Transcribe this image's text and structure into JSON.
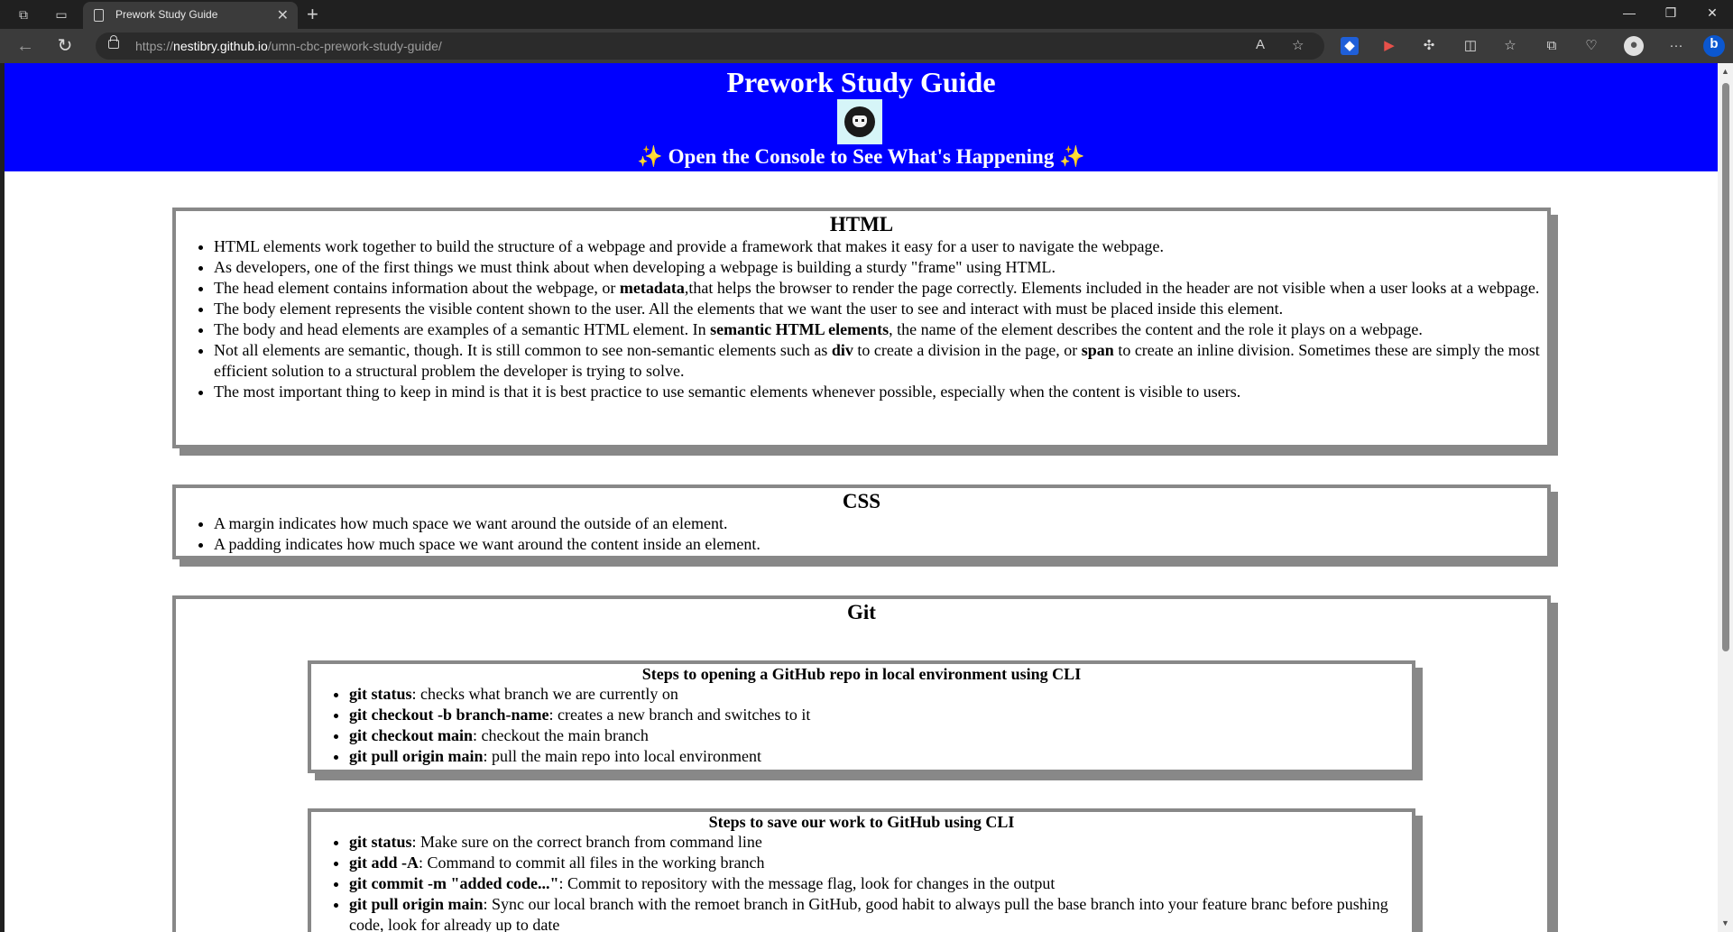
{
  "browser": {
    "tab_title": "Prework Study Guide",
    "url_prefix": "https://",
    "url_host": "nestibry.github.io",
    "url_path": "/umn-cbc-prework-study-guide/"
  },
  "header": {
    "title": "Prework Study Guide",
    "subtitle": "✨ Open the Console to See What's Happening ✨",
    "colors": {
      "background": "#0000ff",
      "text": "#ffffff"
    }
  },
  "sections": {
    "html": {
      "title": "HTML",
      "items": [
        [
          "HTML elements work together to build the structure of a webpage and provide a framework that makes it easy for a user to navigate the webpage."
        ],
        [
          "As developers, one of the first things we must think about when developing a webpage is building a sturdy \"frame\" using HTML."
        ],
        [
          "The head element contains information about the webpage, or ",
          "metadata",
          ",that helps the browser to render the page correctly. Elements included in the header are not visible when a user looks at a webpage."
        ],
        [
          "The body element represents the visible content shown to the user. All the elements that we want the user to see and interact with must be placed inside this element."
        ],
        [
          "The body and head elements are examples of a semantic HTML element. In ",
          "semantic HTML elements",
          ", the name of the element describes the content and the role it plays on a webpage."
        ],
        [
          "Not all elements are semantic, though. It is still common to see non-semantic elements such as ",
          "div",
          " to create a division in the page, or ",
          "span",
          " to create an inline division. Sometimes these are simply the most efficient solution to a structural problem the developer is trying to solve."
        ],
        [
          "The most important thing to keep in mind is that it is best practice to use semantic elements whenever possible, especially when the content is visible to users."
        ]
      ]
    },
    "css": {
      "title": "CSS",
      "items": [
        [
          "A margin indicates how much space we want around the outside of an element."
        ],
        [
          "A padding indicates how much space we want around the content inside an element."
        ]
      ]
    },
    "git": {
      "title": "Git",
      "groups": [
        {
          "title": "Steps to opening a GitHub repo in local environment using CLI",
          "items": [
            [
              "",
              "git status",
              ": checks what branch we are currently on"
            ],
            [
              "",
              "git checkout -b branch-name",
              ": creates a new branch and switches to it"
            ],
            [
              "",
              "git checkout main",
              ": checkout the main branch"
            ],
            [
              "",
              "git pull origin main",
              ": pull the main repo into local environment"
            ]
          ]
        },
        {
          "title": "Steps to save our work to GitHub using CLI",
          "items": [
            [
              "",
              "git status",
              ": Make sure on the correct branch from command line"
            ],
            [
              "",
              "git add -A",
              ": Command to commit all files in the working branch"
            ],
            [
              "",
              "git commit -m \"added code...\"",
              ": Commit to repository with the message flag, look for changes in the output"
            ],
            [
              "",
              "git pull origin main",
              ": Sync our local branch with the remoet branch in GitHub, good habit to always pull the base branch into your feature branc before pushing code, look for already up to date"
            ]
          ]
        }
      ]
    }
  }
}
